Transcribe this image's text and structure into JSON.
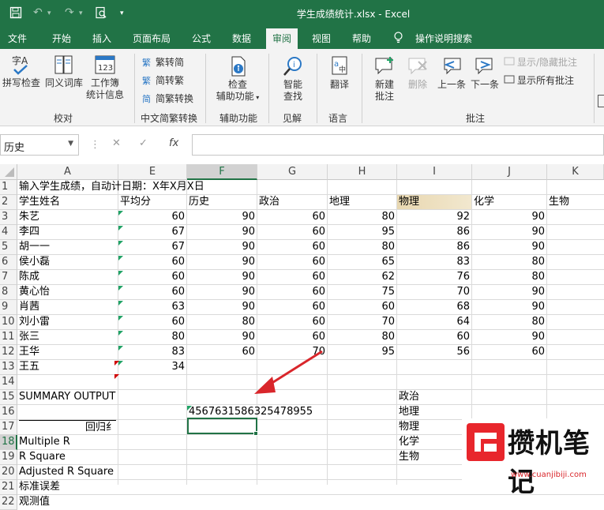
{
  "title_bar": {
    "doc_title": "学生成绩统计.xlsx  -  Excel"
  },
  "menu_tabs": [
    "文件",
    "开始",
    "插入",
    "页面布局",
    "公式",
    "数据",
    "审阅",
    "视图",
    "帮助",
    "操作说明搜索"
  ],
  "ribbon": {
    "proofing": {
      "spell_check": "拼写检查",
      "thesaurus": "同义词库",
      "workbook_stats": [
        "工作簿",
        "统计信息"
      ],
      "label": "校对"
    },
    "chinese_conversion": {
      "to_simplified": "繁转简",
      "to_traditional": "简转繁",
      "convert": "简繁转换",
      "label": "中文简繁转换"
    },
    "accessibility": {
      "check": [
        "检查",
        "辅助功能"
      ],
      "label": "辅助功能"
    },
    "insights": {
      "smart_lookup": [
        "智能",
        "查找"
      ],
      "label": "见解"
    },
    "language": {
      "translate": "翻译",
      "label": "语言"
    },
    "comments": {
      "new": [
        "新建",
        "批注"
      ],
      "delete": "删除",
      "previous": "上一条",
      "next": "下一条",
      "show_hide": "显示/隐藏批注",
      "show_all": "显示所有批注",
      "label": "批注"
    }
  },
  "formula_bar": {
    "name_box": "历史",
    "fx": "fx",
    "content": ""
  },
  "grid": {
    "columns": [
      "A",
      "E",
      "F",
      "G",
      "H",
      "I",
      "J",
      "K"
    ],
    "selected_column": "F",
    "rows": [
      "1",
      "2",
      "3",
      "4",
      "5",
      "6",
      "7",
      "8",
      "9",
      "10",
      "11",
      "12",
      "13",
      "14",
      "15",
      "16",
      "17",
      "18",
      "19",
      "20",
      "21",
      "22"
    ],
    "selected_row": "18",
    "a1": "输入学生成绩，自动计日期：X年X月X日",
    "headers": [
      "学生姓名",
      "平均分",
      "历史",
      "政治",
      "地理",
      "物理",
      "化学",
      "生物"
    ],
    "students": [
      {
        "name": "朱艺",
        "avg": "60",
        "hist": "90",
        "pol": "60",
        "geo": "80",
        "phy": "92",
        "chem": "90"
      },
      {
        "name": "李四",
        "avg": "67",
        "hist": "90",
        "pol": "60",
        "geo": "95",
        "phy": "86",
        "chem": "90"
      },
      {
        "name": "胡一一",
        "avg": "67",
        "hist": "90",
        "pol": "60",
        "geo": "80",
        "phy": "86",
        "chem": "90"
      },
      {
        "name": "侯小磊",
        "avg": "60",
        "hist": "90",
        "pol": "60",
        "geo": "65",
        "phy": "83",
        "chem": "80"
      },
      {
        "name": "陈成",
        "avg": "60",
        "hist": "90",
        "pol": "60",
        "geo": "62",
        "phy": "76",
        "chem": "80"
      },
      {
        "name": "黄心怡",
        "avg": "60",
        "hist": "90",
        "pol": "60",
        "geo": "75",
        "phy": "70",
        "chem": "90"
      },
      {
        "name": "肖茜",
        "avg": "63",
        "hist": "90",
        "pol": "60",
        "geo": "60",
        "phy": "68",
        "chem": "90"
      },
      {
        "name": "刘小雷",
        "avg": "60",
        "hist": "80",
        "pol": "60",
        "geo": "70",
        "phy": "64",
        "chem": "80"
      },
      {
        "name": "张三",
        "avg": "80",
        "hist": "90",
        "pol": "60",
        "geo": "80",
        "phy": "60",
        "chem": "90"
      },
      {
        "name": "王华",
        "avg": "83",
        "hist": "60",
        "pol": "70",
        "geo": "95",
        "phy": "56",
        "chem": "60"
      },
      {
        "name": "王五",
        "avg": "34",
        "hist": "",
        "pol": "",
        "geo": "",
        "phy": "",
        "chem": ""
      }
    ],
    "summary_output": "SUMMARY OUTPUT",
    "long_number": "4567631586325478955",
    "regression_header": "回归纟",
    "stats_labels": [
      "Multiple R",
      "R Square",
      "Adjusted R Square",
      "标准误差",
      "观测值"
    ],
    "subject_list": [
      "政治",
      "地理",
      "物理",
      "化学",
      "生物"
    ]
  },
  "watermark": {
    "text": "攒机笔记",
    "url": "www.cuanjibiji.com"
  },
  "colors": {
    "excel_green": "#217346",
    "physics_header": "#e6d6b0",
    "arrow": "#d9262b",
    "comment_marker": "#d00000",
    "number_marker": "#21a366"
  }
}
